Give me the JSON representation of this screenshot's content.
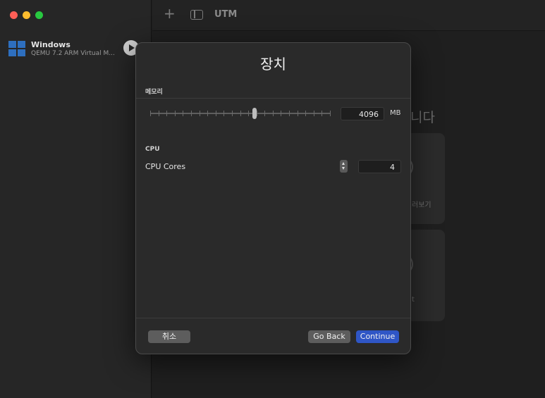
{
  "colors": {
    "close": "#fe5f57",
    "minimize": "#febc2e",
    "zoom": "#28c840",
    "accent": "#2f56c6",
    "windows_logo": "#2e6fbf"
  },
  "sidebar": {
    "vm": {
      "name": "Windows",
      "description": "QEMU 7.2 ARM Virtual M...",
      "icon": "windows-logo-icon"
    }
  },
  "toolbar": {
    "title": "UTM",
    "add_icon": "plus-icon",
    "sidebar_icon": "sidebar-toggle-icon"
  },
  "background": {
    "heading": "니다",
    "card1_text": "러보기",
    "card2_text": "t"
  },
  "modal": {
    "title": "장치",
    "memory": {
      "section_label": "메모리",
      "value": "4096",
      "unit": "MB",
      "slider_fraction": 0.58
    },
    "cpu": {
      "section_label": "CPU",
      "cores_label": "CPU Cores",
      "value": "4"
    },
    "buttons": {
      "cancel": "취소",
      "back": "Go Back",
      "continue": "Continue"
    }
  }
}
